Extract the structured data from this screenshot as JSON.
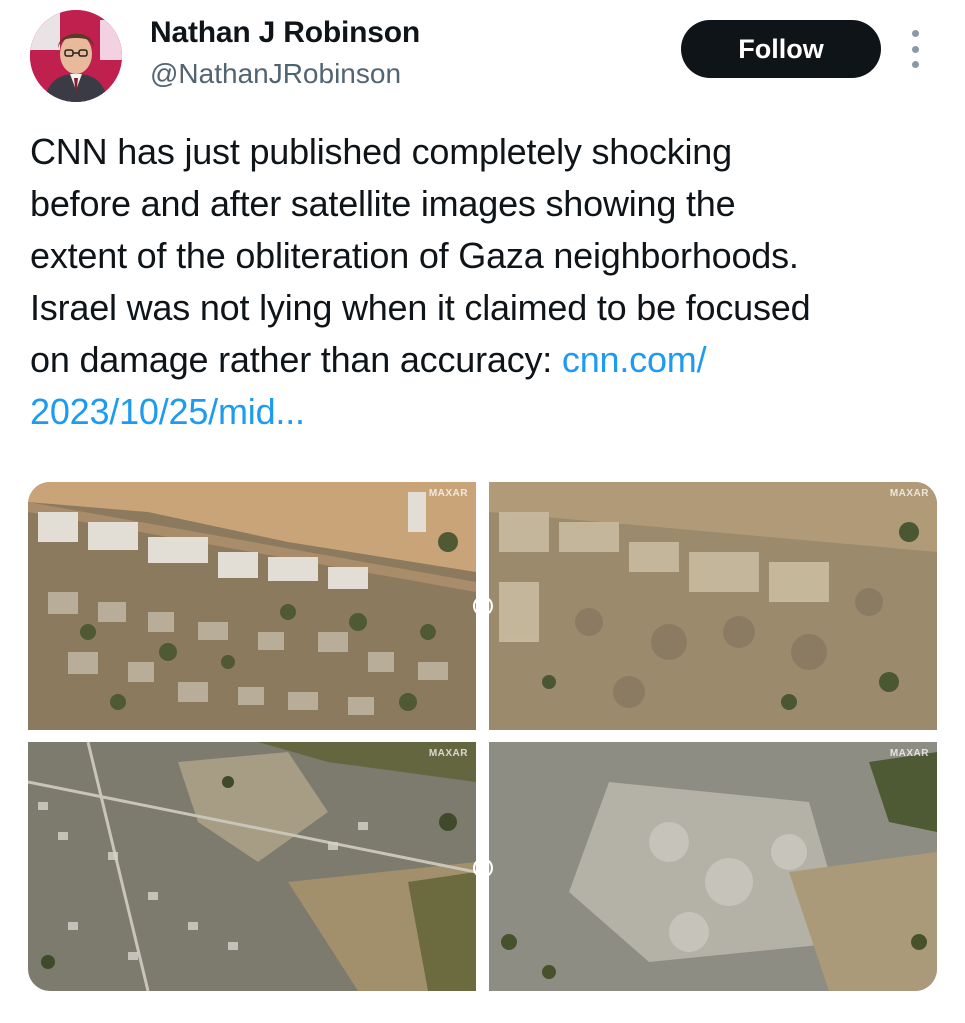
{
  "author": {
    "name": "Nathan J Robinson",
    "handle": "@NathanJRobinson",
    "avatar_icon": "profile-photo"
  },
  "actions": {
    "follow_label": "Follow",
    "more_icon": "vertical-ellipsis-icon"
  },
  "tweet": {
    "lines": [
      "CNN has just published completely shocking",
      "before and after satellite images showing the",
      "extent of the obliteration of Gaza neighborhoods.",
      "Israel was not lying when it claimed to be focused",
      "on damage rather than accuracy: "
    ],
    "link_part1": "cnn.com/",
    "link_part2": "2023/10/25/mid..."
  },
  "media": {
    "watermark": "MAXAR",
    "images": [
      {
        "label": "before-image-top",
        "kind": "before"
      },
      {
        "label": "after-image-top",
        "kind": "after"
      },
      {
        "label": "before-image-bottom",
        "kind": "before"
      },
      {
        "label": "after-image-bottom",
        "kind": "after"
      }
    ]
  },
  "colors": {
    "link": "#1d9bf0",
    "follow_bg": "#0f1419",
    "secondary_text": "#536471"
  }
}
